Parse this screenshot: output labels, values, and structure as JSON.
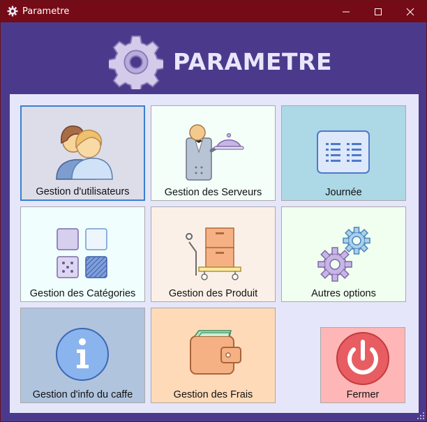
{
  "window": {
    "title": "Parametre"
  },
  "header": {
    "title": "PARAMETRE"
  },
  "tiles": [
    {
      "label": "Gestion d'utilisateurs",
      "icon": "users-icon"
    },
    {
      "label": "Gestion des Serveurs",
      "icon": "waiter-icon"
    },
    {
      "label": "Journée",
      "icon": "list-icon"
    },
    {
      "label": "Gestion des Catégories",
      "icon": "categories-icon"
    },
    {
      "label": "Gestion des Produit",
      "icon": "cart-cabinet-icon"
    },
    {
      "label": "Autres options",
      "icon": "gears-icon"
    },
    {
      "label": "Gestion d'info du caffe",
      "icon": "info-icon"
    },
    {
      "label": "Gestion des Frais",
      "icon": "wallet-icon"
    },
    {
      "label": "Fermer",
      "icon": "power-icon"
    }
  ],
  "colors": {
    "titlebar": "#740b16",
    "background": "#4b3a8c",
    "panel": "#e6e6fa",
    "heading": "#e9e6fb"
  }
}
